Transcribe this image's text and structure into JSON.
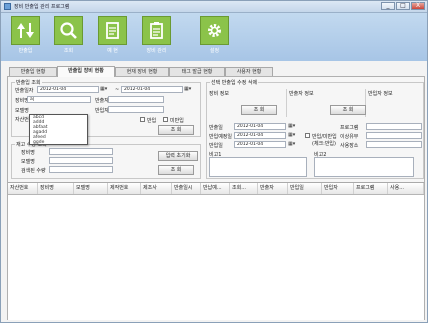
{
  "window": {
    "title": "장비 반출입 관리 프로그램",
    "minimize": "_",
    "maximize": "□",
    "close": "X"
  },
  "toolbar": {
    "buttons": [
      {
        "label": "반출입",
        "icon": "up-down-arrows-icon"
      },
      {
        "label": "조회",
        "icon": "search-icon"
      },
      {
        "label": "예 현",
        "icon": "document-icon"
      },
      {
        "label": "장비 관리",
        "icon": "clipboard-icon"
      },
      {
        "label": "설정",
        "icon": "gear-icon"
      }
    ],
    "accent": "#8bc34a"
  },
  "tabs": [
    "반출입 현황",
    "반출입 장비 현황",
    "현재 장비 현황",
    "태그 발급 현황",
    "사용자 현황"
  ],
  "left": {
    "group_title": "반출입 조회",
    "date_label": "반출일자",
    "date_from": "2012-01-04",
    "date_to": "2012-01-04",
    "tilde": "~",
    "equip_label": "장비명",
    "equip_value": "a|",
    "model_label": "모델명",
    "asset_label": "자산번호",
    "carrier_label": "반출자",
    "receiver_label": "반입자",
    "chk_out": "반입",
    "chk_in": "미반입",
    "search_btn": "조 회",
    "combo_items": [
      "abcd",
      "addd",
      "abfaat",
      "agadd",
      "afeed",
      "ggde"
    ],
    "stock_title": "재고 수량 조회",
    "stock_equip": "장비명",
    "stock_model": "모델명",
    "stock_count": "검색된 수량",
    "init_btn": "입력 초기화",
    "stock_btn": "조 회"
  },
  "right": {
    "group_title": "선택 반출입 수정 삭제",
    "equip_info": "장비 정보",
    "carrier_info": "반출자 정보",
    "receiver_info": "반입자 정보",
    "search_btn1": "조 회",
    "search_btn2": "조 회",
    "out_date_label": "반출일",
    "out_date": "2012-01-04",
    "plan_date_label": "반입예정일",
    "plan_date": "2012-01-04",
    "in_date_label": "반입일",
    "in_date": "2012-01-04",
    "chk_inout": "반입/미반입",
    "chk_note": "(체크:반입)",
    "program_label": "프로그램",
    "purpose_label": "이상유무",
    "place_label": "사용장소",
    "note1_label": "비고1",
    "note2_label": "비고2"
  },
  "grid": {
    "columns": [
      "자산번호",
      "장비명",
      "모델명",
      "제작번호",
      "제조사",
      "반출일시",
      "반납예...",
      "조회...",
      "반출자",
      "반입일",
      "반입자",
      "프로그램",
      "사용..."
    ]
  }
}
